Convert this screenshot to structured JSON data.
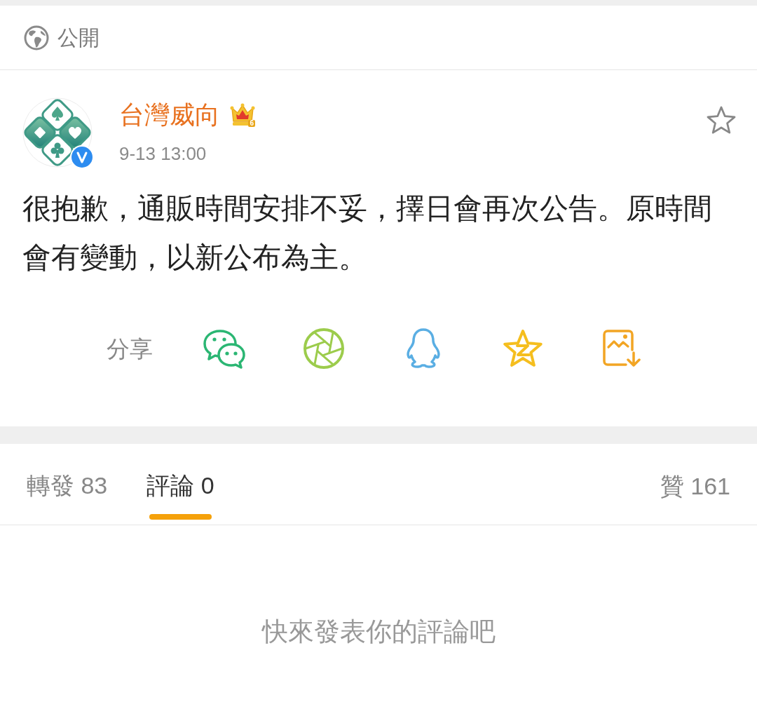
{
  "visibility": {
    "label": "公開"
  },
  "post": {
    "author": {
      "name": "台灣威向",
      "member_level": "6",
      "verified": true,
      "time": "9-13 13:00"
    },
    "starred": false,
    "text": "很抱歉，通販時間安排不妥，擇日會再次公告。原時間會有變動，以新公布為主。"
  },
  "share": {
    "label": "分享",
    "targets": [
      {
        "kind": "wechat"
      },
      {
        "kind": "moments"
      },
      {
        "kind": "qq"
      },
      {
        "kind": "qzone"
      },
      {
        "kind": "save_image"
      }
    ]
  },
  "tabs": [
    {
      "label": "轉發",
      "count": "83",
      "selected": false
    },
    {
      "label": "評論",
      "count": "0",
      "selected": true
    }
  ],
  "likes": {
    "label": "贊",
    "count": "161"
  },
  "empty_comments": "快來發表你的評論吧"
}
